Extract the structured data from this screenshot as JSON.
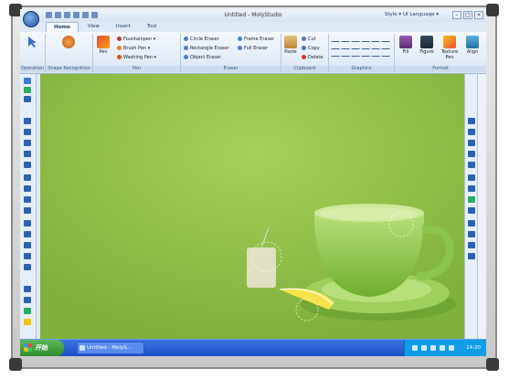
{
  "window": {
    "title": "Untitled - MolyStudio",
    "style_label": "Style",
    "language_label": "UI Language"
  },
  "tabs": [
    {
      "label": "Home",
      "active": true
    },
    {
      "label": "View",
      "active": false
    },
    {
      "label": "Insert",
      "active": false
    },
    {
      "label": "Tool",
      "active": false
    }
  ],
  "ribbon": {
    "groups": {
      "operation": "Operation",
      "shape_recognition": "Shape Recognition",
      "pen": "Pen",
      "eraser": "Eraser",
      "clipboard": "Clipboard",
      "graphics": "Graphics",
      "format": "Format"
    },
    "pen": {
      "pen_label": "Pen",
      "fountainpen": "Fountainpen",
      "brush_pen": "Brush Pen",
      "washing_pen": "Washing Pen"
    },
    "eraser": {
      "circle": "Circle Eraser",
      "rectangle": "Rectangle Eraser",
      "object": "Object Eraser",
      "frame": "Frame Eraser",
      "full": "Full Eraser"
    },
    "clipboard": {
      "paste": "Paste",
      "cut": "Cut",
      "copy": "Copy",
      "delete": "Delete"
    },
    "format": {
      "fill": "Fill",
      "figure": "Figure",
      "texture_pen": "Texture Pen",
      "align": "Align"
    }
  },
  "taskbar": {
    "start_label": "开始",
    "task_item": "Untitled - MolyS...",
    "clock": "14:20"
  },
  "colors": {
    "canvas": "#8fc048",
    "ribbon_bg": "#f4f8fd",
    "accent": "#2c62b4"
  }
}
